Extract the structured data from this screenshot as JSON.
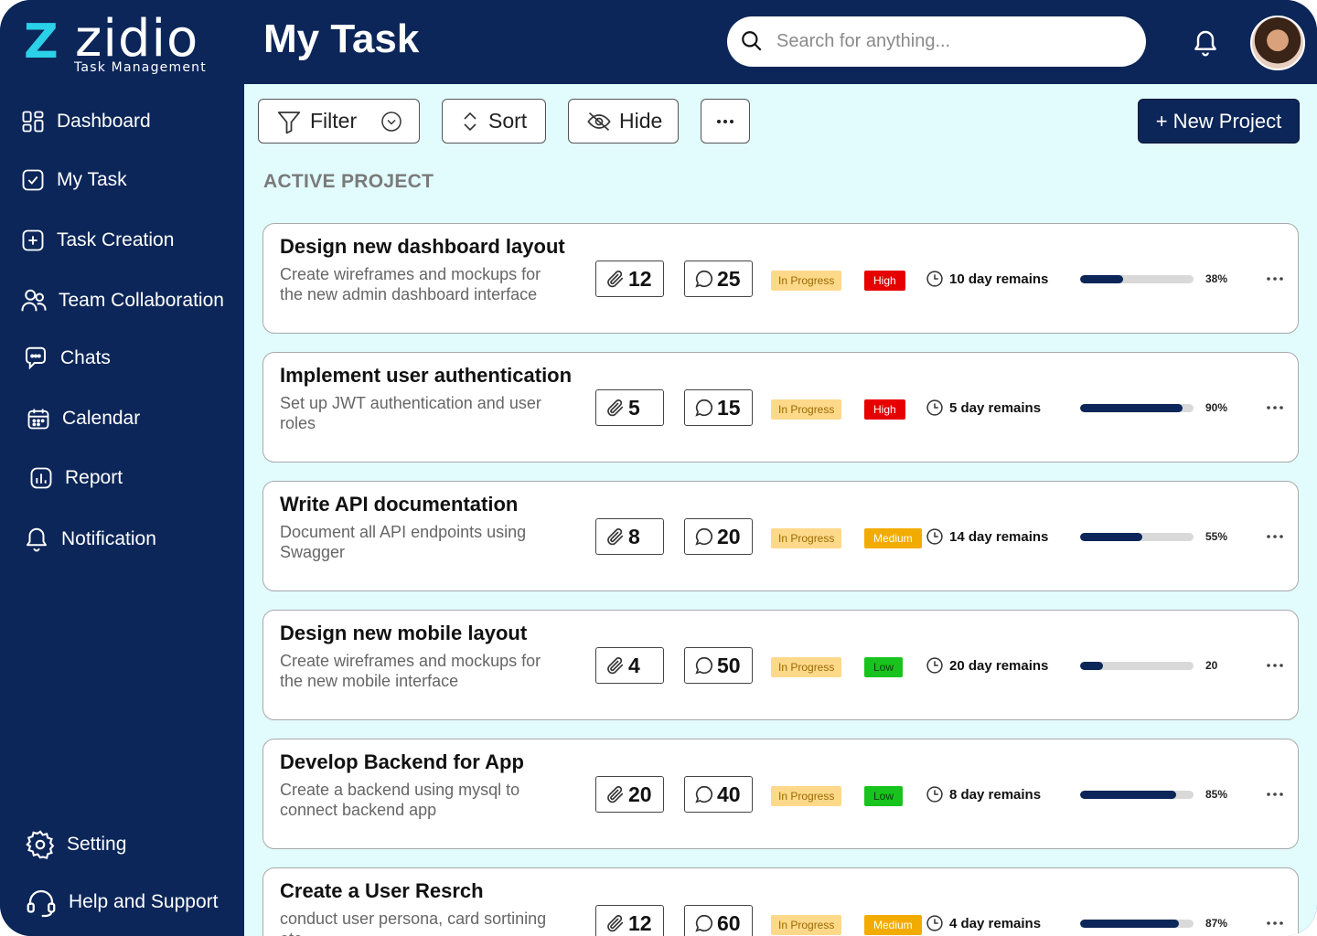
{
  "brand": {
    "name": "zidio",
    "mark": "Z",
    "tagline": "Task Management"
  },
  "header": {
    "title": "My Task",
    "search_placeholder": "Search for anything..."
  },
  "sidebar": {
    "items": [
      {
        "label": "Dashboard",
        "icon": "grid-icon"
      },
      {
        "label": "My Task",
        "icon": "checkbox-icon"
      },
      {
        "label": "Task Creation",
        "icon": "plus-square-icon"
      },
      {
        "label": "Team Collaboration",
        "icon": "users-icon"
      },
      {
        "label": "Chats",
        "icon": "chat-icon"
      },
      {
        "label": "Calendar",
        "icon": "calendar-icon"
      },
      {
        "label": "Report",
        "icon": "bar-chart-icon"
      },
      {
        "label": "Notification",
        "icon": "bell-icon"
      }
    ],
    "bottom": [
      {
        "label": "Setting",
        "icon": "gear-icon"
      },
      {
        "label": "Help and Support",
        "icon": "headset-icon"
      }
    ]
  },
  "toolbar": {
    "filter": "Filter",
    "sort": "Sort",
    "hide": "Hide",
    "new_project": "+ New Project"
  },
  "section_title": "ACTIVE PROJECT",
  "colors": {
    "navy": "#0c2659",
    "high": "#e60000",
    "medium": "#f2ac00",
    "low": "#18c31e",
    "in_progress": "#ffd98a"
  },
  "projects": [
    {
      "title": "Design new dashboard layout",
      "description": "Create wireframes and mockups for the new admin dashboard interface",
      "attachments": "12",
      "comments": "25",
      "status": "In Progress",
      "priority": "High",
      "remaining": "10 day remains",
      "progress": 38,
      "progress_label": "38%"
    },
    {
      "title": "Implement user authentication",
      "description": "Set up JWT authentication and user roles",
      "attachments": "5",
      "comments": "15",
      "status": "In Progress",
      "priority": "High",
      "remaining": "5 day remains",
      "progress": 90,
      "progress_label": "90%"
    },
    {
      "title": "Write API documentation",
      "description": "Document all API endpoints using Swagger",
      "attachments": "8",
      "comments": "20",
      "status": "In Progress",
      "priority": "Medium",
      "remaining": "14 day remains",
      "progress": 55,
      "progress_label": "55%"
    },
    {
      "title": "Design new mobile layout",
      "description": "Create wireframes and mockups for the new mobile interface",
      "attachments": "4",
      "comments": "50",
      "status": "In Progress",
      "priority": "Low",
      "remaining": "20 day remains",
      "progress": 20,
      "progress_label": "20"
    },
    {
      "title": "Develop Backend for App",
      "description": "Create a backend using mysql to connect backend app",
      "attachments": "20",
      "comments": "40",
      "status": "In Progress",
      "priority": "Low",
      "remaining": "8 day remains",
      "progress": 85,
      "progress_label": "85%"
    },
    {
      "title": "Create a User Resrch",
      "description": "conduct user persona, card sortining etc",
      "attachments": "12",
      "comments": "60",
      "status": "In Progress",
      "priority": "Medium",
      "remaining": "4 day remains",
      "progress": 87,
      "progress_label": "87%"
    }
  ]
}
